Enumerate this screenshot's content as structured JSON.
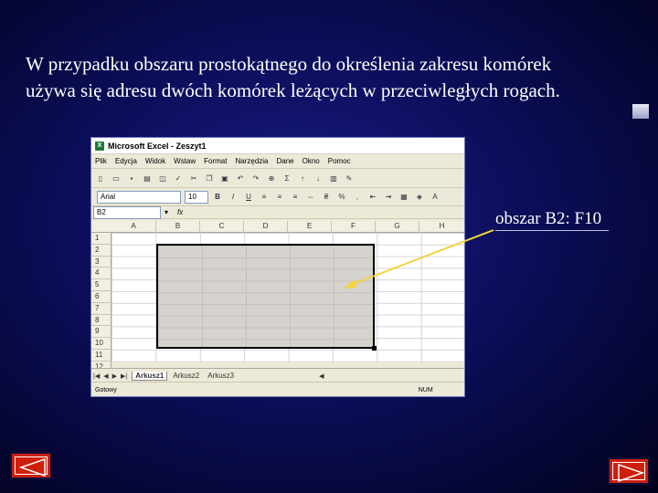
{
  "slide": {
    "line1": "W przypadku obszaru prostokątnego do określenia zakresu komórek",
    "line2": "używa się adresu dwóch komórek leżących w przeciwległych rogach."
  },
  "excel": {
    "title": "Microsoft Excel - Zeszyt1",
    "menu": [
      "Plik",
      "Edycja",
      "Widok",
      "Wstaw",
      "Format",
      "Narzędzia",
      "Dane",
      "Okno",
      "Pomoc"
    ],
    "font_name": "Arial",
    "font_size": "10",
    "bold_btn": "B",
    "italic_btn": "I",
    "underline_btn": "U",
    "name_box": "B2",
    "fx": "fx",
    "columns": [
      "A",
      "B",
      "C",
      "D",
      "E",
      "F",
      "G",
      "H"
    ],
    "rows": [
      "1",
      "2",
      "3",
      "4",
      "5",
      "6",
      "7",
      "8",
      "9",
      "10",
      "11",
      "12"
    ],
    "sheets": [
      "Arkusz1",
      "Arkusz2",
      "Arkusz3"
    ],
    "status_left": "Gotowy",
    "status_right": "NUM"
  },
  "callout": {
    "label": "obszar B2: F10"
  },
  "colors": {
    "accent": "#cd1f0b",
    "arrow": "#f2d43a",
    "selection": "#d6d3ce"
  }
}
